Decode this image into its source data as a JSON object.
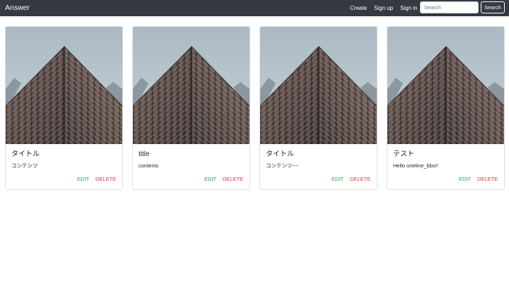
{
  "navbar": {
    "brand": "Answer",
    "links": [
      "Create",
      "Sign up",
      "Sign in"
    ],
    "search_placeholder": "Search",
    "search_button": "Search"
  },
  "cards": [
    {
      "title": "タイトル",
      "text": "コンテンツ",
      "edit": "EDIT",
      "delete": "DELETE",
      "image": "building-photo"
    },
    {
      "title": "title",
      "text": "contents",
      "edit": "EDIT",
      "delete": "DELETE",
      "image": "building-photo"
    },
    {
      "title": "タイトル",
      "text": "コンテンツ~~",
      "edit": "EDIT",
      "delete": "DELETE",
      "image": "building-photo"
    },
    {
      "title": "テスト",
      "text": "Hello oneline_bbs!!",
      "edit": "EDIT",
      "delete": "DELETE",
      "image": "building-photo"
    }
  ],
  "colors": {
    "navbar_bg": "#343a40",
    "edit": "#28a745",
    "delete": "#dc3545"
  }
}
